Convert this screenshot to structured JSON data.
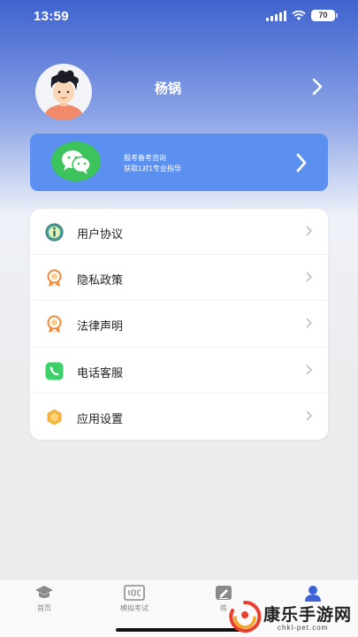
{
  "status_bar": {
    "time": "13:59",
    "battery": "70"
  },
  "profile": {
    "name": "杨锅"
  },
  "banner": {
    "line1": "报考备考咨询",
    "line2": "获取1对1专业指导"
  },
  "menu": {
    "items": [
      {
        "label": "用户协议",
        "icon": "user-agreement-icon"
      },
      {
        "label": "隐私政策",
        "icon": "privacy-medal-icon"
      },
      {
        "label": "法律声明",
        "icon": "legal-medal-icon"
      },
      {
        "label": "电话客服",
        "icon": "phone-icon"
      },
      {
        "label": "应用设置",
        "icon": "settings-hex-icon"
      }
    ]
  },
  "tab_bar": {
    "tabs": [
      {
        "label": "首页",
        "icon": "graduation-cap-icon"
      },
      {
        "label": "模拟考试",
        "icon": "exam-100-icon"
      },
      {
        "label": "练",
        "icon": "practice-edit-icon"
      },
      {
        "label": "",
        "icon": "profile-icon",
        "active": true
      }
    ]
  },
  "watermark": {
    "title": "康乐手游网",
    "subtitle": "chkl-pet.com"
  },
  "colors": {
    "accent": "#3f63cf",
    "banner": "#5b8ff0",
    "wechat": "#3cc35c",
    "active_tab": "#3b63d6"
  }
}
